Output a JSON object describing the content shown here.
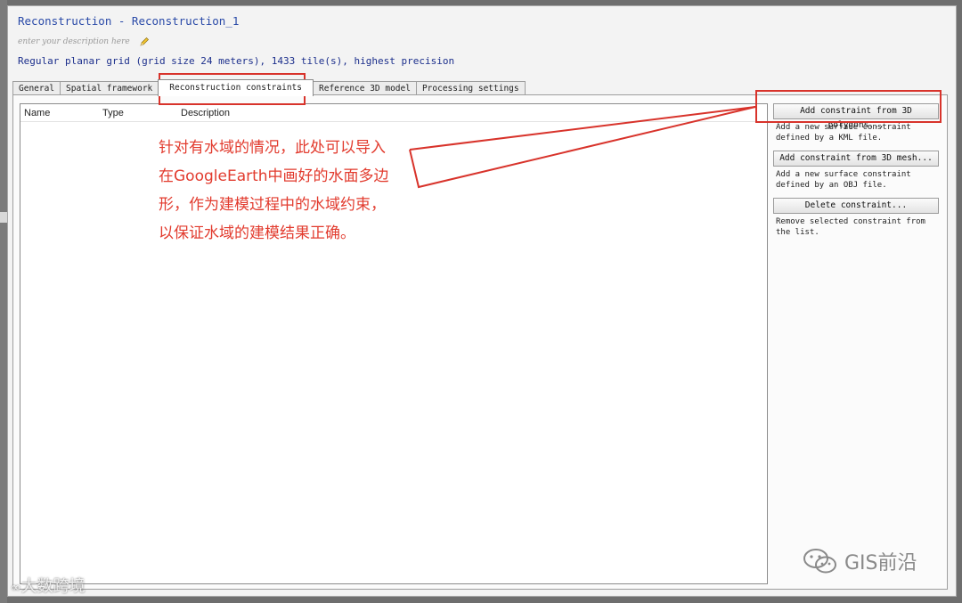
{
  "window": {
    "title": "Reconstruction - Reconstruction_1",
    "description_placeholder": "enter your description here",
    "summary": "Regular planar grid (grid size 24 meters), 1433 tile(s), highest precision"
  },
  "tabs": [
    {
      "label": "General"
    },
    {
      "label": "Spatial framework"
    },
    {
      "label": "Reconstruction constraints",
      "active": true
    },
    {
      "label": "Reference 3D model"
    },
    {
      "label": "Processing settings"
    }
  ],
  "list": {
    "columns": [
      "Name",
      "Type",
      "Description"
    ]
  },
  "actions": {
    "add_polygons": {
      "label": "Add constraint from 3D polygons...",
      "help": "Add a new surface constraint defined by a KML file."
    },
    "add_mesh": {
      "label": "Add constraint from 3D mesh...",
      "help": "Add a new surface constraint defined by an OBJ file."
    },
    "delete": {
      "label": "Delete constraint...",
      "help": "Remove selected constraint from the list."
    }
  },
  "annotation": {
    "lines": [
      "针对有水域的情况，此处可以导入",
      "在GoogleEarth中画好的水面多边",
      "形，作为建模过程中的水域约束，",
      "以保证水域的建模结果正确。"
    ],
    "color": "#e23b2e"
  },
  "watermarks": {
    "left": "大数跨境",
    "right": "GIS前沿"
  },
  "icons": [
    "pencil-icon",
    "wechat-icon"
  ]
}
